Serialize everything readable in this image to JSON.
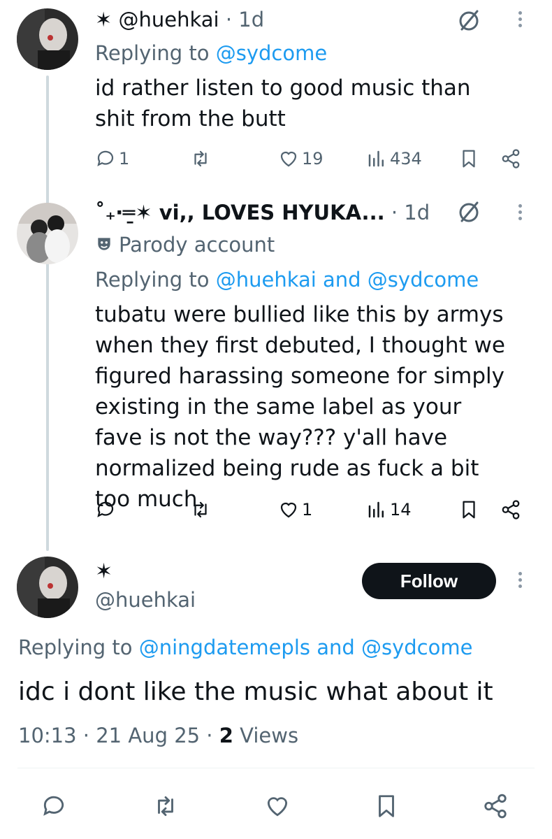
{
  "tweets": [
    {
      "name": "✶ @huehkai",
      "time": "· 1d",
      "replying_prefix": "Replying to",
      "replying_to": "@sydcome",
      "text": "id rather listen to good music than shit from the butt",
      "replies": "1",
      "retweets": "",
      "likes": "19",
      "views": "434"
    },
    {
      "name": "˚₊‧═̱✶ vi,, LOVES HYUKA...",
      "time": "· 1d",
      "badge": "Parody account",
      "replying_prefix": "Replying to",
      "replying_to": "@huehkai and @sydcome",
      "text": "tubatu were bullied like this by armys when they first debuted, I thought we figured harassing someone for simply existing in the same label as your fave is not the way??? y'all have normalized being rude as fuck a bit too much",
      "replies": "",
      "retweets": "",
      "likes": "1",
      "views": "14"
    }
  ],
  "main_tweet": {
    "display_name": "✶",
    "handle": "@huehkai",
    "follow_label": "Follow",
    "replying_prefix": "Replying to",
    "replying_to": "@ningdatemepls and @sydcome",
    "text": "idc i dont like the music what about it",
    "timestamp": "10:13 · 21 Aug 25 ·",
    "views_count": "2",
    "views_label": "Views"
  },
  "colors": {
    "link": "#1d9bf0",
    "secondary": "#536471",
    "thread_line": "#cfd9de"
  },
  "icons": [
    "reply-icon",
    "retweet-icon",
    "like-icon",
    "views-icon",
    "bookmark-icon",
    "share-icon",
    "grok-icon",
    "more-icon",
    "parody-mask-icon"
  ]
}
